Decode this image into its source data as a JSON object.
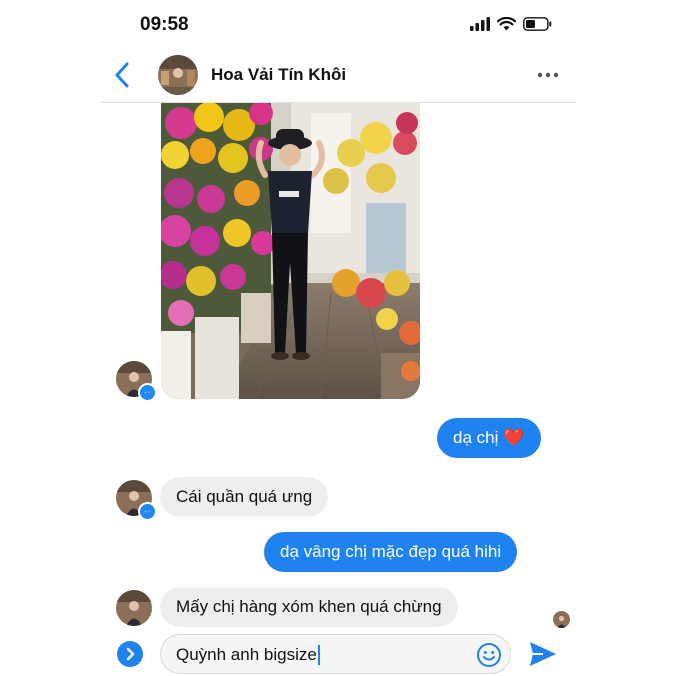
{
  "status_bar": {
    "time": "09:58",
    "icons": [
      "signal-icon",
      "wifi-icon",
      "battery-icon"
    ]
  },
  "header": {
    "contact_name": "Hoa Vải Tín Khôi",
    "back_icon": "chevron-left-icon",
    "more_icon": "more-dots-icon"
  },
  "messages": [
    {
      "direction": "incoming",
      "kind": "photo",
      "content": "woman in black hat posing among artificial flower displays"
    },
    {
      "direction": "outgoing",
      "text": "dạ chị",
      "emoji": "❤️"
    },
    {
      "direction": "incoming",
      "text": "Cái quần quá ưng"
    },
    {
      "direction": "outgoing",
      "text": "dạ vâng chị mặc đẹp quá hihi"
    },
    {
      "direction": "incoming",
      "text": "Mấy chị hàng xóm khen quá chừng"
    }
  ],
  "composer": {
    "input_value": "Quỳnh anh bigsize",
    "expand_icon": "chevron-right-icon",
    "emoji_icon": "smiley-icon",
    "send_icon": "send-icon"
  },
  "colors": {
    "accent": "#1e82f0",
    "incoming_bubble": "#eeeeef",
    "heart": "#e0242c"
  }
}
